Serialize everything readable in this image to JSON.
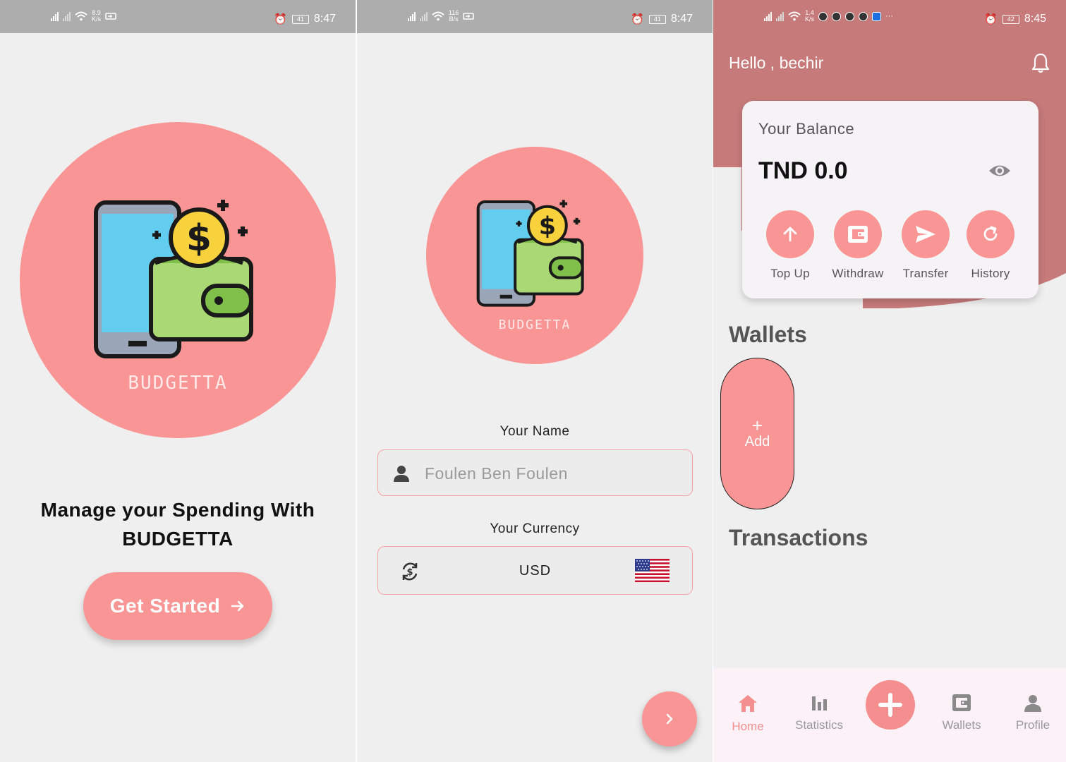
{
  "colors": {
    "accent": "#f99595",
    "header_pink": "#c67a7a",
    "background": "#efefef",
    "status_bar": "#adadad",
    "nav_active": "#f38f8f",
    "nav_inactive": "#9a9a9a"
  },
  "screen1": {
    "status": {
      "net_speed": "8.9",
      "speed_unit": "K/s",
      "battery": "41",
      "time": "8:47"
    },
    "logo_text": "BUDGETTA",
    "headline_line1": "Manage your Spending With",
    "headline_line2": "BUDGETTA",
    "cta_label": "Get Started",
    "cta_icon": "arrow-right-icon"
  },
  "screen2": {
    "status": {
      "net_speed": "116",
      "speed_unit": "B/s",
      "battery": "41",
      "time": "8:47"
    },
    "logo_text": "BUDGETTA",
    "name_label": "Your Name",
    "name_placeholder": "Foulen Ben Foulen",
    "name_icon": "person-icon",
    "currency_label": "Your Currency",
    "currency_value": "USD",
    "currency_icon": "currency-exchange-icon",
    "currency_flag": "us-flag-icon",
    "next_icon": "chevron-right-icon"
  },
  "screen3": {
    "status": {
      "net_speed": "1.4",
      "speed_unit": "K/s",
      "battery": "42",
      "time": "8:45"
    },
    "greeting": "Hello , bechir",
    "balance_label": "Your Balance",
    "balance_value": "TND 0.0",
    "actions": [
      {
        "label": "Top Up",
        "icon": "arrow-up-icon"
      },
      {
        "label": "Withdraw",
        "icon": "wallet-icon"
      },
      {
        "label": "Transfer",
        "icon": "send-icon"
      },
      {
        "label": "History",
        "icon": "refresh-icon"
      }
    ],
    "wallets_title": "Wallets",
    "add_wallet_plus": "+",
    "add_wallet_label": "Add",
    "transactions_title": "Transactions",
    "nav": [
      {
        "label": "Home",
        "icon": "home-icon",
        "active": true
      },
      {
        "label": "Statistics",
        "icon": "bar-chart-icon",
        "active": false
      },
      {
        "label": "Wallets",
        "icon": "wallet-icon",
        "active": false
      },
      {
        "label": "Profile",
        "icon": "profile-icon",
        "active": false
      }
    ],
    "fab_icon": "plus-icon"
  }
}
